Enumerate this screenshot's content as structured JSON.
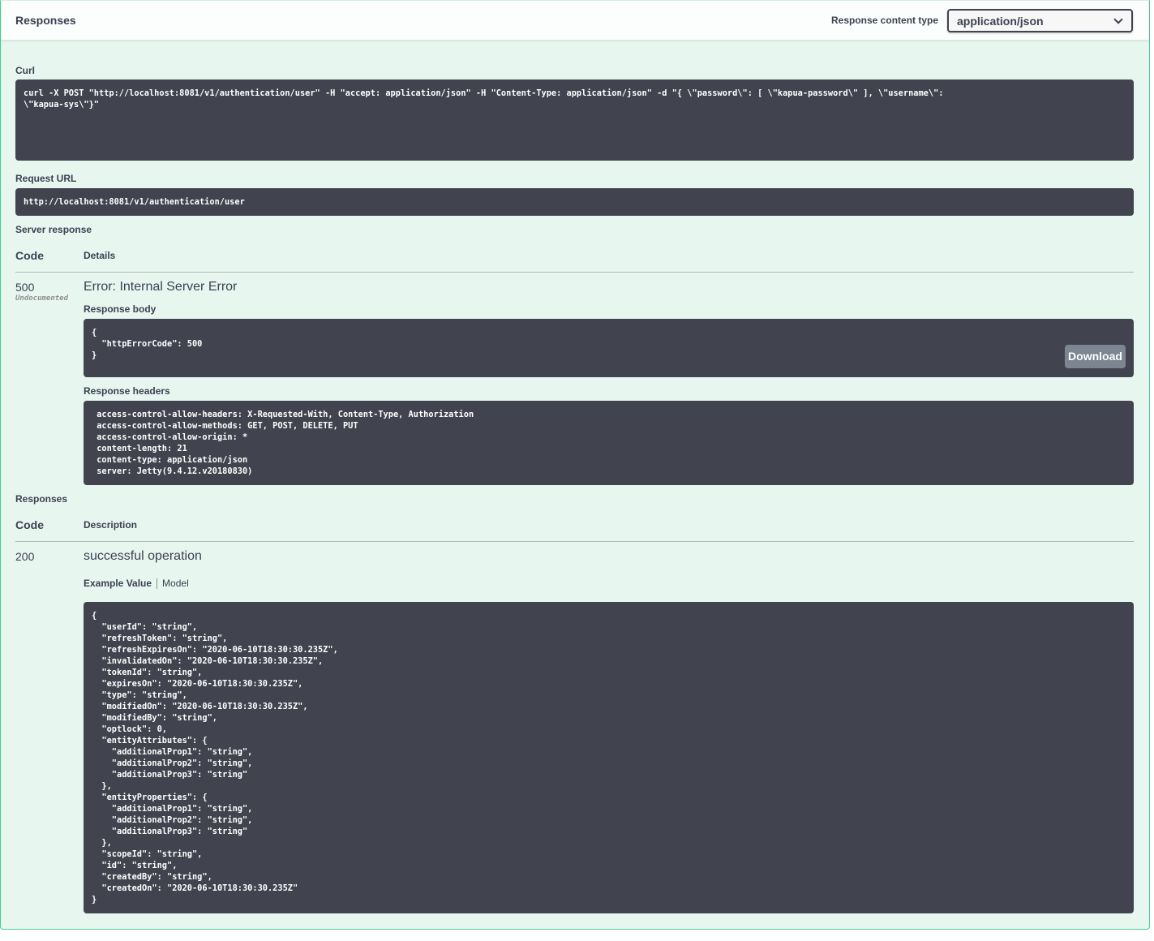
{
  "header": {
    "title": "Responses",
    "content_type_label": "Response content type",
    "content_type_value": "application/json"
  },
  "curl": {
    "label": "Curl",
    "command": "curl -X POST \"http://localhost:8081/v1/authentication/user\" -H \"accept: application/json\" -H \"Content-Type: application/json\" -d \"{ \\\"password\\\": [ \\\"kapua-password\\\" ], \\\"username\\\":\n\\\"kapua-sys\\\"}\""
  },
  "request_url": {
    "label": "Request URL",
    "value": "http://localhost:8081/v1/authentication/user"
  },
  "server_response": {
    "label": "Server response",
    "col_code": "Code",
    "col_details": "Details",
    "code": "500",
    "undocumented": "Undocumented",
    "error_title": "Error: Internal Server Error",
    "body_label": "Response body",
    "body": "{\n  \"httpErrorCode\": 500\n}",
    "download_label": "Download",
    "headers_label": "Response headers",
    "headers": " access-control-allow-headers: X-Requested-With, Content-Type, Authorization\n access-control-allow-methods: GET, POST, DELETE, PUT\n access-control-allow-origin: *\n content-length: 21\n content-type: application/json\n server: Jetty(9.4.12.v20180830)"
  },
  "responses": {
    "label": "Responses",
    "col_code": "Code",
    "col_description": "Description",
    "code": "200",
    "description": "successful operation",
    "tab_example": "Example Value",
    "tab_model": "Model",
    "example": "{\n  \"userId\": \"string\",\n  \"refreshToken\": \"string\",\n  \"refreshExpiresOn\": \"2020-06-10T18:30:30.235Z\",\n  \"invalidatedOn\": \"2020-06-10T18:30:30.235Z\",\n  \"tokenId\": \"string\",\n  \"expiresOn\": \"2020-06-10T18:30:30.235Z\",\n  \"type\": \"string\",\n  \"modifiedOn\": \"2020-06-10T18:30:30.235Z\",\n  \"modifiedBy\": \"string\",\n  \"optlock\": 0,\n  \"entityAttributes\": {\n    \"additionalProp1\": \"string\",\n    \"additionalProp2\": \"string\",\n    \"additionalProp3\": \"string\"\n  },\n  \"entityProperties\": {\n    \"additionalProp1\": \"string\",\n    \"additionalProp2\": \"string\",\n    \"additionalProp3\": \"string\"\n  },\n  \"scopeId\": \"string\",\n  \"id\": \"string\",\n  \"createdBy\": \"string\",\n  \"createdOn\": \"2020-06-10T18:30:30.235Z\"\n}"
  }
}
